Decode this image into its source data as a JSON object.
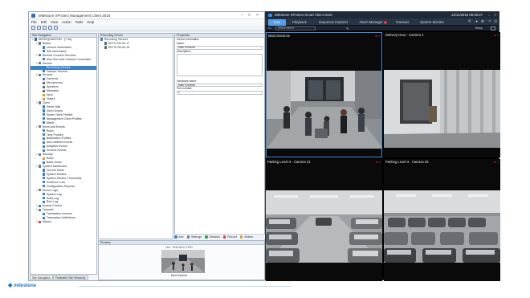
{
  "management_client": {
    "title": "Milestone XProtect Management Client 2016",
    "menu": [
      "File",
      "Edit",
      "View",
      "Action",
      "Tools",
      "Help"
    ],
    "site_nav_header": "Site Navigation",
    "site_nav_root": "DEMOQUANTUM - (7.0a)",
    "tree": [
      {
        "label": "DEMOQUANTUM - (7.0a)",
        "depth": 0,
        "color": "#2b6cb5"
      },
      {
        "label": "Basics",
        "depth": 1,
        "color": "#6b7c8e"
      },
      {
        "label": "License Information",
        "depth": 2,
        "color": "#3a7fc4"
      },
      {
        "label": "Site Information",
        "depth": 2,
        "color": "#3a7fc4"
      },
      {
        "label": "Remote Connect Services",
        "depth": 1,
        "color": "#6b7c8e"
      },
      {
        "label": "Axis One-click Camera Connection",
        "depth": 2,
        "color": "#3a7fc4"
      },
      {
        "label": "Servers",
        "depth": 1,
        "color": "#6b7c8e"
      },
      {
        "label": "Recording Servers",
        "depth": 2,
        "color": "#3a7fc4",
        "selected": true
      },
      {
        "label": "Failover Servers",
        "depth": 2,
        "color": "#3a7fc4"
      },
      {
        "label": "Devices",
        "depth": 1,
        "color": "#6b7c8e"
      },
      {
        "label": "Cameras",
        "depth": 2,
        "color": "#2f7cd6"
      },
      {
        "label": "Microphones",
        "depth": 2,
        "color": "#5a6b7d"
      },
      {
        "label": "Speakers",
        "depth": 2,
        "color": "#5a6b7d"
      },
      {
        "label": "Metadata",
        "depth": 2,
        "color": "#5a6b7d"
      },
      {
        "label": "Input",
        "depth": 2,
        "color": "#d4a020"
      },
      {
        "label": "Output",
        "depth": 2,
        "color": "#d4a020"
      },
      {
        "label": "Client",
        "depth": 1,
        "color": "#6b7c8e"
      },
      {
        "label": "Smart Wall",
        "depth": 2,
        "color": "#3a7fc4"
      },
      {
        "label": "View Groups",
        "depth": 2,
        "color": "#3a7fc4"
      },
      {
        "label": "Smart Client Profiles",
        "depth": 2,
        "color": "#3a7fc4"
      },
      {
        "label": "Management Client Profiles",
        "depth": 2,
        "color": "#3a7fc4"
      },
      {
        "label": "Matrix",
        "depth": 2,
        "color": "#3a7fc4"
      },
      {
        "label": "Rules and Events",
        "depth": 1,
        "color": "#6b7c8e"
      },
      {
        "label": "Rules",
        "depth": 2,
        "color": "#3a7fc4"
      },
      {
        "label": "Time Profiles",
        "depth": 2,
        "color": "#3a7fc4"
      },
      {
        "label": "Notification Profiles",
        "depth": 2,
        "color": "#3a7fc4"
      },
      {
        "label": "User-defined Events",
        "depth": 2,
        "color": "#3a7fc4"
      },
      {
        "label": "Analytics Events",
        "depth": 2,
        "color": "#3a7fc4"
      },
      {
        "label": "Generic Events",
        "depth": 2,
        "color": "#3a7fc4"
      },
      {
        "label": "Security",
        "depth": 1,
        "color": "#6b7c8e"
      },
      {
        "label": "Roles",
        "depth": 2,
        "color": "#d4a020"
      },
      {
        "label": "Basic Users",
        "depth": 2,
        "color": "#3a7fc4"
      },
      {
        "label": "System Dashboard",
        "depth": 1,
        "color": "#6b7c8e"
      },
      {
        "label": "Current Tasks",
        "depth": 2,
        "color": "#3a7fc4"
      },
      {
        "label": "System Monitor",
        "depth": 2,
        "color": "#3a7fc4"
      },
      {
        "label": "System Monitor Thresholds",
        "depth": 2,
        "color": "#3a7fc4"
      },
      {
        "label": "Evidence Lock",
        "depth": 2,
        "color": "#3a7fc4"
      },
      {
        "label": "Configuration Reports",
        "depth": 2,
        "color": "#3a7fc4"
      },
      {
        "label": "Server Logs",
        "depth": 1,
        "color": "#6b7c8e"
      },
      {
        "label": "System Log",
        "depth": 2,
        "color": "#3a7fc4"
      },
      {
        "label": "Audit Log",
        "depth": 2,
        "color": "#3a7fc4"
      },
      {
        "label": "Rule Log",
        "depth": 2,
        "color": "#3a7fc4"
      },
      {
        "label": "Access Control",
        "depth": 1,
        "color": "#3a7fc4"
      },
      {
        "label": "Transact",
        "depth": 1,
        "color": "#6b7c8e"
      },
      {
        "label": "Transaction sources",
        "depth": 2,
        "color": "#3a7fc4"
      },
      {
        "label": "Transaction definitions",
        "depth": 2,
        "color": "#3a7fc4"
      },
      {
        "label": "Alarms",
        "depth": 1,
        "color": "#d04040"
      }
    ],
    "bottom_tabs": [
      "Site Navigation",
      "Federated Site Hierarchy"
    ],
    "recording_header": "Recording Server",
    "recording_tree": [
      {
        "label": "Recording Servers",
        "depth": 0
      },
      {
        "label": "DKTS-PM-00-17",
        "depth": 1
      },
      {
        "label": "DKTS-PM-00-16",
        "depth": 1
      }
    ],
    "properties_header": "Properties",
    "properties": {
      "section": "Device information",
      "name_label": "Name:",
      "name_value": "Main Entrance",
      "description_label": "Description:",
      "hardware_label": "Hardware name:",
      "hardware_value": "Main Entrance",
      "port_label": "Port number:",
      "port_value": "1"
    },
    "property_tabs": [
      "Info",
      "Settings",
      "Streams",
      "Record",
      "Motion"
    ],
    "preview_header": "Preview",
    "preview_time": "Live · 2016-04-07 15:01",
    "preview_caption": "Main Entrance"
  },
  "smart_client": {
    "title": "Milestone XProtect Smart Client 2016",
    "datetime": "14/11/2015 09:46:27",
    "tabs": [
      "Live",
      "Playback",
      "Sequence Explorer",
      "Alarm Manager",
      "Transact",
      "System Monitor"
    ],
    "alarm_badge": true,
    "active_tab": "Live",
    "view_selector": "Select view",
    "setup_label": "Setup",
    "cameras": [
      {
        "title": "Main Entrance"
      },
      {
        "title": "Delivery Door - Camera 2"
      },
      {
        "title": "Parking Level-3 - Camera 31"
      },
      {
        "title": "Parking Level-3 - Camera 26"
      }
    ]
  },
  "brand": {
    "logo_text": "milestone",
    "accent": "#1a74c9",
    "selection": "#3d80d0",
    "live_tab": "#57a0e8"
  }
}
